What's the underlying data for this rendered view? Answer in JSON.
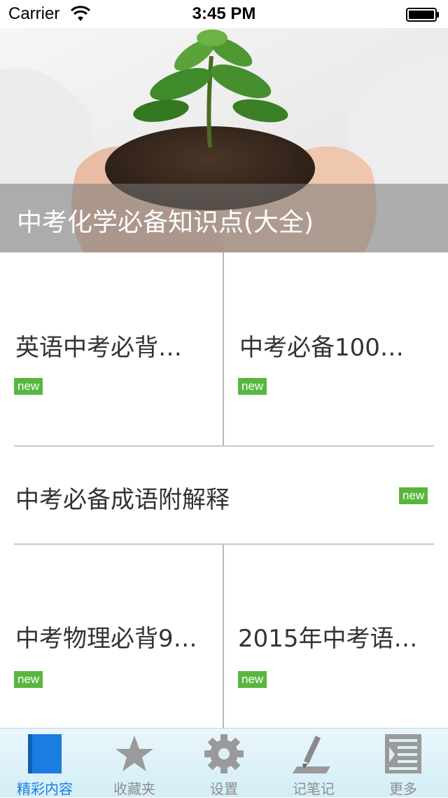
{
  "status_bar": {
    "carrier": "Carrier",
    "time": "3:45 PM"
  },
  "hero": {
    "title": "中考化学必备知识点(大全)",
    "image": "hands-holding-seedling-photo"
  },
  "items": [
    {
      "title": "英语中考必背…",
      "badge": "new"
    },
    {
      "title": "中考必备100…",
      "badge": "new"
    },
    {
      "title": "中考必备成语附解释",
      "badge": "new"
    },
    {
      "title": "中考物理必背9…",
      "badge": "new"
    },
    {
      "title": "2015年中考语…",
      "badge": "new"
    }
  ],
  "tabs": [
    {
      "label": "精彩内容",
      "icon": "book-icon",
      "active": true
    },
    {
      "label": "收藏夹",
      "icon": "star-icon",
      "active": false
    },
    {
      "label": "设置",
      "icon": "gear-icon",
      "active": false
    },
    {
      "label": "记笔记",
      "icon": "pen-icon",
      "active": false
    },
    {
      "label": "更多",
      "icon": "more-list-icon",
      "active": false
    }
  ],
  "colors": {
    "badge": "#58b63d",
    "active_tab": "#1a7de0",
    "inactive_tab": "#8e8e8e"
  }
}
